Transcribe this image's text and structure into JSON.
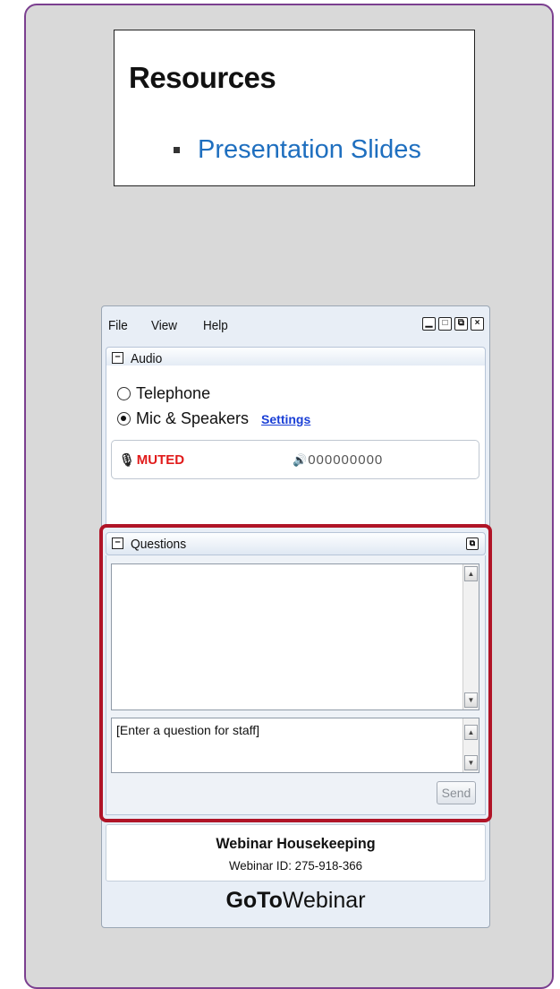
{
  "resources": {
    "heading": "Resources",
    "link": "Presentation Slides"
  },
  "window": {
    "menu": [
      "File",
      "View",
      "Help"
    ],
    "controls": [
      "minimize-icon",
      "maximize-icon",
      "popout-icon",
      "close-icon"
    ]
  },
  "audio": {
    "title": "Audio",
    "options": [
      {
        "label": "Telephone",
        "selected": false
      },
      {
        "label": "Mic & Speakers",
        "selected": true
      }
    ],
    "settings_label": "Settings",
    "muted_label": "MUTED",
    "volume_label": "000000000"
  },
  "questions": {
    "title": "Questions",
    "input_placeholder": "[Enter a question for staff]",
    "send_label": "Send"
  },
  "info": {
    "title": "Webinar Housekeeping",
    "webinar_id": "Webinar ID: 275-918-366"
  },
  "brand": {
    "bold": "GoTo",
    "regular": "Webinar"
  },
  "colors": {
    "frame_purple": "#7b3f8f",
    "highlight_red": "#b01427",
    "link_blue": "#1f6fbf",
    "muted_red": "#e11b1b"
  }
}
